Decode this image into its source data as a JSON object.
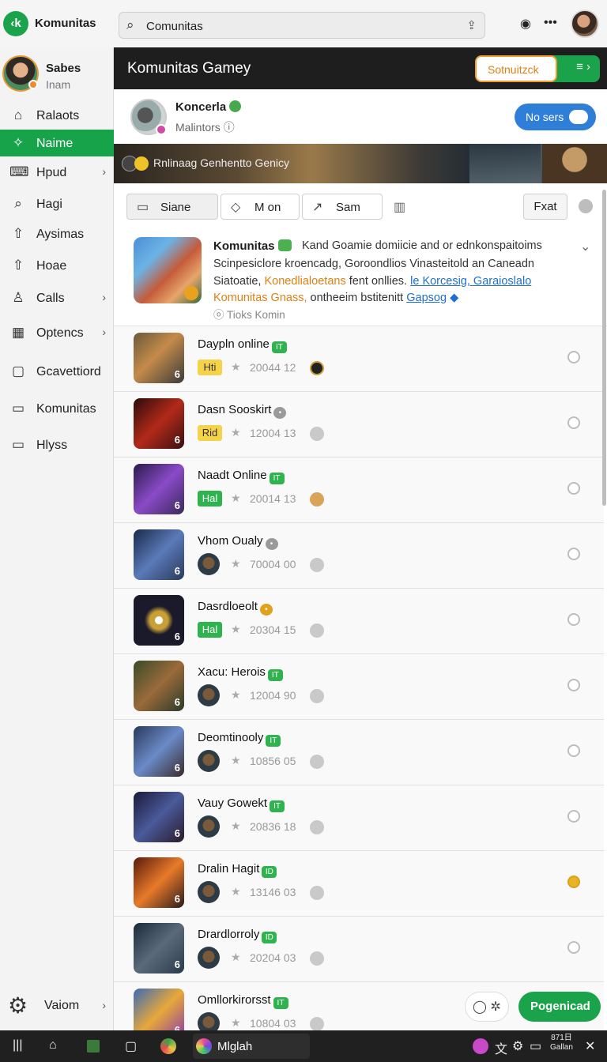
{
  "app": {
    "title": "Komunitas",
    "logo": "‹k"
  },
  "search": {
    "value": "Comunitas"
  },
  "header_icons": [
    "help-icon",
    "more-icon"
  ],
  "user": {
    "name": "Sabes",
    "subtitle": "Inam"
  },
  "sidebar": {
    "items": [
      {
        "label": "Ralaots",
        "icon": "home-icon",
        "chevron": false,
        "active": false
      },
      {
        "label": "Naime",
        "icon": "sparkle-icon",
        "chevron": false,
        "active": true
      },
      {
        "label": "Hpud",
        "icon": "keyboard-icon",
        "chevron": true,
        "active": false
      },
      {
        "label": "Hagi",
        "icon": "search-icon",
        "chevron": false,
        "active": false
      },
      {
        "label": "Aysimas",
        "icon": "share-icon",
        "chevron": false,
        "active": false
      },
      {
        "label": "Hoae",
        "icon": "share-icon",
        "chevron": false,
        "active": false
      },
      {
        "label": "Calls",
        "icon": "person-icon",
        "chevron": true,
        "active": false
      },
      {
        "label": "Optencs",
        "icon": "grid-icon",
        "chevron": true,
        "active": false
      },
      {
        "label": "Gcavettiord",
        "icon": "square-icon",
        "chevron": false,
        "active": false
      },
      {
        "label": "Komunitas",
        "icon": "chat-icon",
        "chevron": false,
        "active": false
      },
      {
        "label": "Hlyss",
        "icon": "chat-icon",
        "chevron": false,
        "active": false
      }
    ],
    "settings": {
      "label": "Vaiom"
    }
  },
  "main": {
    "title": "Komunitas Gamey",
    "header_button": "Sotnuitzck",
    "community": {
      "name": "Koncerla",
      "subtitle": "Malintors",
      "toggle_label": "No sers"
    },
    "banner_text": "Rnlinaag Genhentto Genicy",
    "filters": [
      {
        "label": "Siane",
        "icon": "window-icon"
      },
      {
        "label": "M on",
        "icon": "tag-icon"
      },
      {
        "label": "Sam",
        "icon": "arrow-icon"
      }
    ],
    "filter_right": "Fxat",
    "featured": {
      "title": "Komunitas",
      "line1_rest": "Kand Goamie domiicie and  or ednkonspaitoims",
      "line2": "Scinpesiclore kroencadg, Goroondlios Vinasteitold an Caneadn",
      "line3_a": "Siatoatie, ",
      "line3_orange": "Konedlialoetans",
      "line3_b": " fent onllies. ",
      "line3_link": "le Korcesig, Garaioslalo",
      "line4_orange": "Komunitas Gnass,",
      "line4_b": "  ontheeim bstitenitt ",
      "line4_link": "Gapsog",
      "meta": "Tioks Komin"
    },
    "games": [
      {
        "title": "Daypln online",
        "badge": "IT",
        "badge_style": "green",
        "tag": "Hti",
        "tag_style": "yellow",
        "count": "20044 12",
        "mini": "dark",
        "more": "normal"
      },
      {
        "title": "Dasn Sooskirt",
        "badge": "•",
        "badge_style": "gray",
        "tag": "Rid",
        "tag_style": "yellow",
        "count": "12004 13",
        "mini": "normal",
        "more": "normal"
      },
      {
        "title": "Naadt Online",
        "badge": "IT",
        "badge_style": "green",
        "tag": "Hal",
        "tag_style": "green",
        "count": "20014 13",
        "mini": "cute",
        "more": "normal"
      },
      {
        "title": "Vhom Oualy",
        "badge": "•",
        "badge_style": "gray",
        "tag": "",
        "tag_style": "avatar",
        "count": "70004 00",
        "mini": "normal",
        "more": "normal"
      },
      {
        "title": "Dasrdloeolt",
        "badge": "•",
        "badge_style": "gold",
        "tag": "Hal",
        "tag_style": "green",
        "count": "20304 15",
        "mini": "normal",
        "more": "normal"
      },
      {
        "title": "Xacu: Herois",
        "badge": "IT",
        "badge_style": "green",
        "tag": "",
        "tag_style": "avatar",
        "count": "12004 90",
        "mini": "normal",
        "more": "normal"
      },
      {
        "title": "Deomtinooly",
        "badge": "IT",
        "badge_style": "green",
        "tag": "",
        "tag_style": "avatar",
        "count": "10856 05",
        "mini": "normal",
        "more": "normal"
      },
      {
        "title": "Vauy Gowekt",
        "badge": "IT",
        "badge_style": "green",
        "tag": "",
        "tag_style": "avatar",
        "count": "20836 18",
        "mini": "normal",
        "more": "normal"
      },
      {
        "title": "Dralin Hagit",
        "badge": "ID",
        "badge_style": "green",
        "tag": "",
        "tag_style": "avatar",
        "count": "13146 03",
        "mini": "normal",
        "more": "gold"
      },
      {
        "title": "Drardlorroly",
        "badge": "ID",
        "badge_style": "green",
        "tag": "",
        "tag_style": "avatar",
        "count": "20204 03",
        "mini": "normal",
        "more": "normal"
      },
      {
        "title": "Omllorkirorsst",
        "badge": "IT",
        "badge_style": "green",
        "tag": "",
        "tag_style": "avatar",
        "count": "10804 03",
        "mini": "normal",
        "more": "normal"
      }
    ],
    "fab_label": "Pogenicad"
  },
  "taskbar": {
    "active_label": "Mlglah",
    "clock_line1": "871日",
    "clock_line2": "Gallan"
  },
  "colors": {
    "accent": "#1aa34a",
    "header": "#1e1e1e",
    "link": "#1e6fd0",
    "orange": "#e07f12"
  }
}
